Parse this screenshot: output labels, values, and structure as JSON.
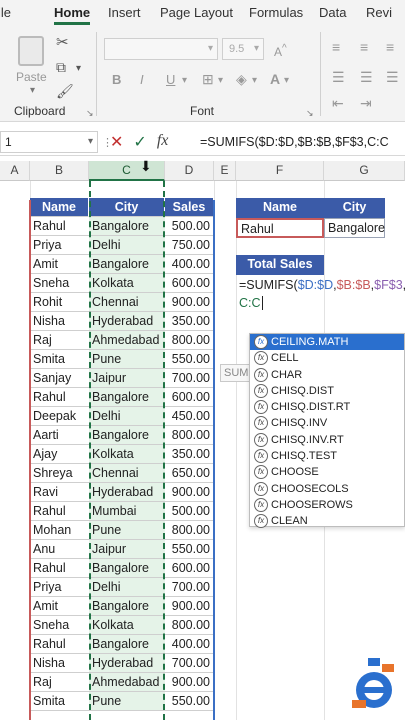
{
  "ribbon": {
    "tabs": [
      "File",
      "Home",
      "Insert",
      "Page Layout",
      "Formulas",
      "Data",
      "Revi"
    ],
    "active_tab": "Home",
    "groups": {
      "clipboard": "Clipboard",
      "font": "Font"
    },
    "paste_label": "Paste",
    "font_size": "9.5",
    "format_buttons": [
      "B",
      "I",
      "U"
    ]
  },
  "formula_bar": {
    "namebox": "1",
    "formula": "=SUMIFS($D:$D,$B:$B,$F$3,C:C"
  },
  "columns": [
    "A",
    "B",
    "C",
    "D",
    "E",
    "F",
    "G"
  ],
  "table": {
    "headers": [
      "Name",
      "City",
      "Sales"
    ],
    "rows": [
      [
        "Rahul",
        "Bangalore",
        "500.00"
      ],
      [
        "Priya",
        "Delhi",
        "750.00"
      ],
      [
        "Amit",
        "Bangalore",
        "400.00"
      ],
      [
        "Sneha",
        "Kolkata",
        "600.00"
      ],
      [
        "Rohit",
        "Chennai",
        "900.00"
      ],
      [
        "Nisha",
        "Hyderabad",
        "350.00"
      ],
      [
        "Raj",
        "Ahmedabad",
        "800.00"
      ],
      [
        "Smita",
        "Pune",
        "550.00"
      ],
      [
        "Sanjay",
        "Jaipur",
        "700.00"
      ],
      [
        "Rahul",
        "Bangalore",
        "600.00"
      ],
      [
        "Deepak",
        "Delhi",
        "450.00"
      ],
      [
        "Aarti",
        "Bangalore",
        "800.00"
      ],
      [
        "Ajay",
        "Kolkata",
        "350.00"
      ],
      [
        "Shreya",
        "Chennai",
        "650.00"
      ],
      [
        "Ravi",
        "Hyderabad",
        "900.00"
      ],
      [
        "Rahul",
        "Mumbai",
        "500.00"
      ],
      [
        "Mohan",
        "Pune",
        "800.00"
      ],
      [
        "Anu",
        "Jaipur",
        "550.00"
      ],
      [
        "Rahul",
        "Bangalore",
        "600.00"
      ],
      [
        "Priya",
        "Delhi",
        "700.00"
      ],
      [
        "Amit",
        "Bangalore",
        "900.00"
      ],
      [
        "Sneha",
        "Kolkata",
        "800.00"
      ],
      [
        "Rahul",
        "Bangalore",
        "400.00"
      ],
      [
        "Nisha",
        "Hyderabad",
        "700.00"
      ],
      [
        "Raj",
        "Ahmedabad",
        "900.00"
      ],
      [
        "Smita",
        "Pune",
        "550.00"
      ]
    ]
  },
  "criteria": {
    "headers": [
      "Name",
      "City"
    ],
    "values": [
      "Rahul",
      "Bangalore"
    ]
  },
  "total_sales": {
    "label": "Total Sales",
    "formula_parts": [
      "=SUMIFS(",
      "$D:$D",
      ",",
      "$B:$B",
      ",",
      "$F$3",
      ",",
      "C:C"
    ]
  },
  "tooltip_hint": "SUM",
  "autocomplete": [
    "CEILING.MATH",
    "CELL",
    "CHAR",
    "CHISQ.DIST",
    "CHISQ.DIST.RT",
    "CHISQ.INV",
    "CHISQ.INV.RT",
    "CHISQ.TEST",
    "CHOOSE",
    "CHOOSECOLS",
    "CHOOSEROWS",
    "CLEAN"
  ],
  "colors": {
    "accent": "#217346",
    "header_blue": "#3b5ba8",
    "selected": "#2a6fce"
  }
}
